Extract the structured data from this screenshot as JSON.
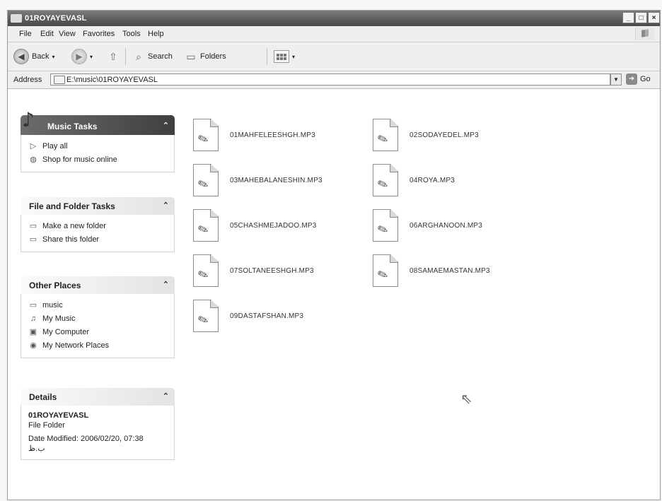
{
  "window": {
    "title": "01ROYAYEVASL",
    "min_label": "_",
    "max_label": "□",
    "close_label": "×"
  },
  "menu": [
    "File",
    "Edit",
    "View",
    "Favorites",
    "Tools",
    "Help"
  ],
  "toolbar": {
    "back_label": "Back",
    "search_label": "Search",
    "folders_label": "Folders"
  },
  "address": {
    "label": "Address",
    "path": "E:\\music\\01ROYAYEVASL",
    "go_label": "Go"
  },
  "music_tasks": {
    "title": "Music Tasks",
    "items": [
      "Play all",
      "Shop for music online"
    ]
  },
  "file_folder_tasks": {
    "title": "File and Folder Tasks",
    "items": [
      "Make a new folder",
      "Share this folder"
    ]
  },
  "other_places": {
    "title": "Other Places",
    "items": [
      "music",
      "My Music",
      "My Computer",
      "My Network Places"
    ]
  },
  "details": {
    "title": "Details",
    "name": "01ROYAYEVASL",
    "type": "File Folder",
    "date": "Date Modified: 2006/02/20, 07:38 ب.ظ"
  },
  "files": [
    "01MAHFELEESHGH.MP3",
    "02SODAYEDEL.MP3",
    "03MAHEBALANESHIN.MP3",
    "04ROYA.MP3",
    "05CHASHMEJADOO.MP3",
    "06ARGHANOON.MP3",
    "07SOLTANEESHGH.MP3",
    "08SAMAEMASTAN.MP3",
    "09DASTAFSHAN.MP3"
  ],
  "icons": {
    "file": "mp3-file-icon",
    "play": "play-icon",
    "globe": "globe-icon"
  }
}
